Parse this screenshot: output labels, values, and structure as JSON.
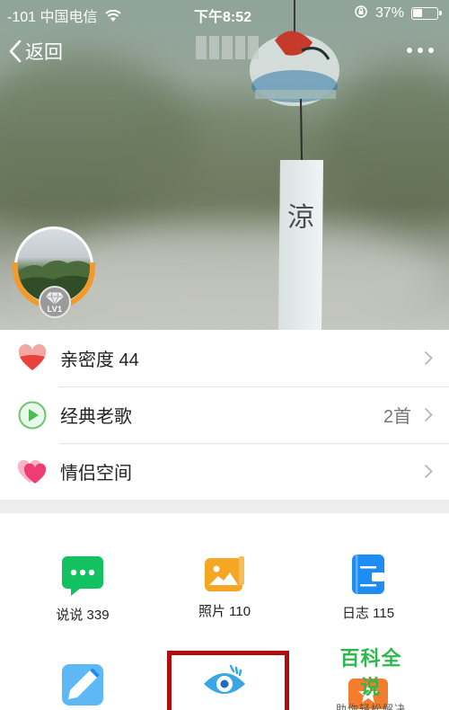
{
  "status_bar": {
    "carrier": "-101 中国电信",
    "time": "下午8:52",
    "battery": "37%"
  },
  "nav": {
    "back_label": "返回"
  },
  "profile": {
    "level_label": "LV1"
  },
  "wind_chime_text": "涼",
  "list": [
    {
      "label": "亲密度 44",
      "value": ""
    },
    {
      "label": "经典老歌",
      "value": "2首"
    },
    {
      "label": "情侣空间",
      "value": ""
    }
  ],
  "grid": {
    "talk": "说说 339",
    "photo": "照片 110",
    "diary": "日志 115"
  },
  "watermark": {
    "title": "百科全说",
    "subtitle": "助你轻松解决"
  },
  "colors": {
    "talk_green": "#12c15f",
    "photo_orange": "#f5a623",
    "diary_blue": "#1e8df3",
    "highlight_red": "#b00d0d",
    "watermark_green": "#2eb84b"
  }
}
